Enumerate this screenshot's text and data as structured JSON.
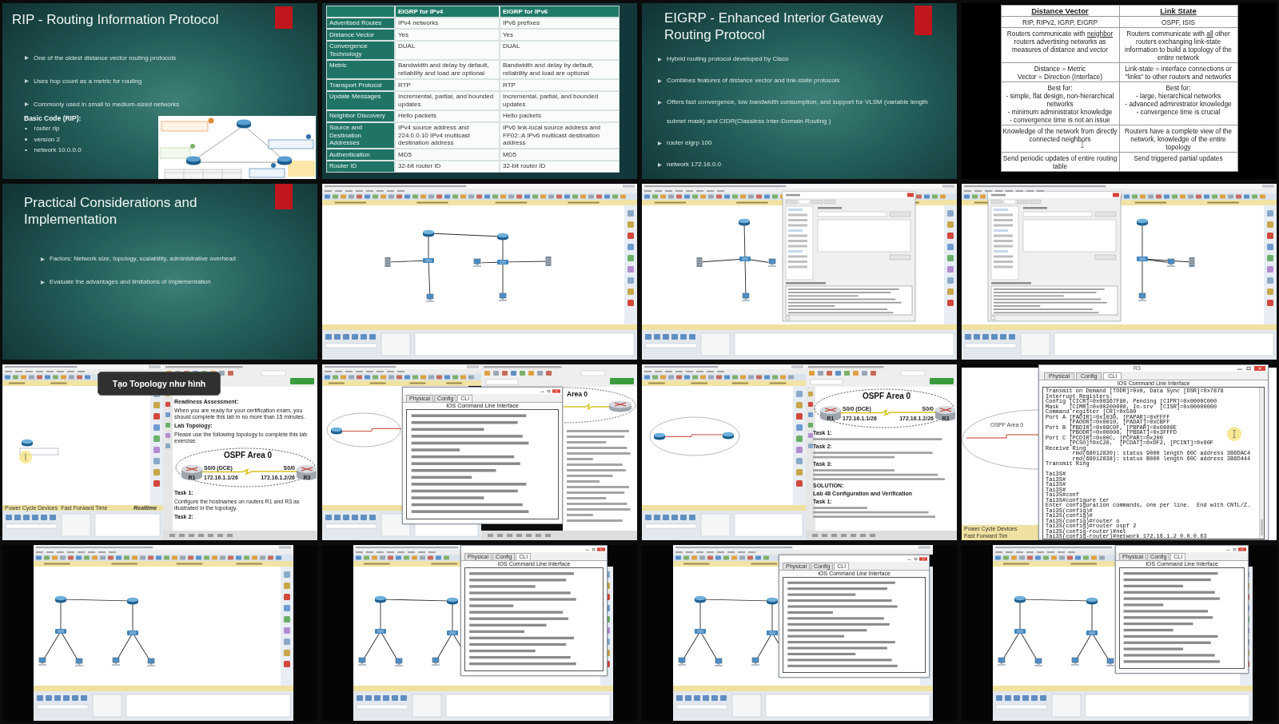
{
  "tiles": [
    {
      "kind": "slide",
      "title": "RIP - Routing Information Protocol",
      "bullets": [
        "One of the oldest distance vector routing protocols",
        "Uses hop count as a metric for routing",
        "Commonly used in small to medium-sized networks"
      ],
      "code": {
        "heading": "Basic Code (RIP):",
        "lines": [
          "router rip",
          "version 2",
          "network 10.0.0.0"
        ]
      },
      "figure": {
        "kind": "routing_diagram"
      }
    },
    {
      "kind": "feature_table",
      "columns": [
        "EIGRP for IPv4",
        "EIGRP for IPv6"
      ],
      "rows": [
        {
          "label": "Advertised Routes",
          "values": [
            "IPv4 networks",
            "IPv6 prefixes"
          ]
        },
        {
          "label": "Distance Vector",
          "values": [
            "Yes",
            "Yes"
          ]
        },
        {
          "label": "Convergence Technology",
          "values": [
            "DUAL",
            "DUAL"
          ]
        },
        {
          "label": "Metric",
          "values": [
            "Bandwidth and delay by default, reliability and load are optional",
            "Bandwidth and delay by default, reliability and load are optional"
          ]
        },
        {
          "label": "Transport Protocol",
          "values": [
            "RTP",
            "RTP"
          ]
        },
        {
          "label": "Update Messages",
          "values": [
            "Incremental, partial, and bounded updates",
            "Incremental, partial, and bounded updates"
          ]
        },
        {
          "label": "Neighbor Discovery",
          "values": [
            "Hello packets",
            "Hello packets"
          ]
        },
        {
          "label": "Source and Destination Addresses",
          "values": [
            "IPv4 source address and 224.0.0.10 IPv4 multicast destination address",
            "IPv6 link-local source address and FF02::A IPv6 multicast destination address"
          ]
        },
        {
          "label": "Authentication",
          "values": [
            "MD5",
            "MD5"
          ]
        },
        {
          "label": "Router ID",
          "values": [
            "32-bit router ID",
            "32-bit router ID"
          ]
        }
      ]
    },
    {
      "kind": "slide",
      "title": "EIGRP - Enhanced Interior Gateway Routing Protocol",
      "bullets": [
        "Hybrid routing protocol developed by Cisco",
        "Combines features of distance vector and link-state protocols",
        "Offers fast convergence, low bandwidth consumption, and support for VLSM (variable length subnet mask) and CIDR(Classless Inter-Domain Routing )",
        "router eigrp 100",
        "network 172.16.0.0"
      ]
    },
    {
      "kind": "comparison_table",
      "columns": [
        "Distance Vector",
        "Link State"
      ],
      "rows": [
        [
          {
            "parts": [
              {
                "text": "RIP, RIPv2, IGRP, EIGRP",
                "underline": false
              }
            ]
          },
          {
            "parts": [
              {
                "text": "OSPF, ISIS",
                "underline": false
              }
            ]
          }
        ],
        [
          {
            "parts": [
              {
                "text": "Routers communicate with ",
                "underline": false
              },
              {
                "text": "neighbor",
                "underline": true
              },
              {
                "text": " routers advertising networks as measures of distance and vector",
                "underline": false
              }
            ]
          },
          {
            "parts": [
              {
                "text": "Routers communicate with ",
                "underline": false
              },
              {
                "text": "all",
                "underline": true
              },
              {
                "text": " other routers exchanging link-state information to build a topology of the entire network",
                "underline": false
              }
            ]
          }
        ],
        [
          {
            "parts": [
              {
                "text": "Distance = Metric\nVector = Direction (Interface)",
                "underline": false
              }
            ]
          },
          {
            "parts": [
              {
                "text": "Link-state = interface connections or \"links\" to other routers and networks",
                "underline": false
              }
            ]
          }
        ],
        [
          {
            "parts": [
              {
                "text": "Best for:\n- simple, flat design, non-hierarchical networks\n- minimum administrator knowledge\n- convergence time is not an issue",
                "underline": false
              }
            ]
          },
          {
            "parts": [
              {
                "text": "Best for:\n- large, hierarchical networks\n- advanced administrator knowledge\n- convergence time is crucial",
                "underline": false
              }
            ]
          }
        ],
        [
          {
            "parts": [
              {
                "text": "Knowledge of the network from directly connected neighbors",
                "underline": false
              }
            ]
          },
          {
            "parts": [
              {
                "text": "Routers have a complete view of the network, knowledge of the entire topology",
                "underline": false
              }
            ]
          }
        ],
        [
          {
            "parts": [
              {
                "text": "Send periodic updates of entire routing table",
                "underline": false
              }
            ]
          },
          {
            "parts": [
              {
                "text": "Send triggered partial updates",
                "underline": false
              }
            ]
          }
        ]
      ]
    },
    {
      "kind": "slide",
      "title": "Practical Considerations and Implementation",
      "bullets": [
        "Factors: Network size, topology, scalability, administrative overhead",
        "Evaluate the advantages and limitations of implementation"
      ]
    },
    {
      "kind": "pt_topology"
    },
    {
      "kind": "pt_config"
    },
    {
      "kind": "pt_config"
    },
    {
      "kind": "pt_lab_doc",
      "caption": "Tạo Topology như hình",
      "status_buttons": [
        "Power Cycle Devices",
        "Fast Forward Time"
      ],
      "mode_label": "Realtime",
      "doc": {
        "intro": [
          {
            "kind": "heading",
            "text": "Readiness Assessment:"
          },
          {
            "kind": "paragraph",
            "text": "When you are ready for your certification exam, you should complete this lab in no more than 15 minutes."
          },
          {
            "kind": "heading",
            "text": "Lab Topology:"
          },
          {
            "kind": "paragraph",
            "text": "Please use the following topology to complete this lab exercise:"
          }
        ],
        "topology": {
          "title": "OSPF Area 0",
          "routers": [
            "R1",
            "R3"
          ],
          "ends": [
            {
              "interface": "S0/0 (DCE)",
              "address": "172.16.1.1/26"
            },
            {
              "interface": "S0/0",
              "address": "172.16.1.2/26"
            }
          ]
        },
        "after": [
          {
            "kind": "heading",
            "text": "Task 1:"
          },
          {
            "kind": "paragraph",
            "text": "Configure the hostnames on routers R1 and R3 as illustrated in the topology."
          },
          {
            "kind": "heading",
            "text": "Task 2:"
          }
        ]
      }
    },
    {
      "kind": "pt_cli_doc",
      "cli": {
        "tabs": [
          {
            "label": "Physical",
            "selected": false
          },
          {
            "label": "Config",
            "selected": false
          },
          {
            "label": "CLI",
            "selected": true
          }
        ],
        "heading": "IOS Command Line Interface"
      },
      "doc_title": "Area 0"
    },
    {
      "kind": "pt_doc",
      "doc": {
        "topology": {
          "title": "OSPF Area 0",
          "routers": [
            "R1",
            "R3"
          ],
          "ends": [
            {
              "interface": "S0/0 (DCE)",
              "address": "172.16.1.1/26"
            },
            {
              "interface": "S0/0",
              "address": "172.16.1.2/26"
            }
          ]
        },
        "headings": [
          "Task 1:",
          "Task 2:",
          "Task 3:",
          "SOLUTION:",
          "Lab 48 Configuration and Verification",
          "Task 1:"
        ]
      }
    },
    {
      "kind": "cli_focus",
      "area_label": "OSPF Area 0",
      "status_buttons": [
        "Power Cycle Devices",
        "Fast Forward Tim"
      ],
      "cli": {
        "window_title": "R3",
        "tabs": [
          {
            "label": "Physical",
            "selected": false
          },
          {
            "label": "Config",
            "selected": false
          },
          {
            "label": "CLI",
            "selected": true
          }
        ],
        "heading": "IOS Command Line Interface",
        "output": [
          [
            "Transmit on Demand [TODR]=0x0, Data Sync [DSR]=0x7878",
            "Interrupt Registers:",
            "Config [CICR]=0x00367F80, Pending [CIPR]=0x0000C000",
            "Mask   [CIMR]=0x00200000, In-srv  [CISR]=0x00000000",
            "Command register [CR]=0x580",
            "Port A [PADIR]=0x1030, [PAPAR]=0xFFFF",
            "       [PAODR]=0x0010, [PADAT]=0xCBFF",
            "Port B [PBDIR]=0x09C0F, [PBPAR]=0x0800E",
            "       [PBODR]=0x00000, [PBDAT]=0x3FFFD",
            "Port C [PCDIR]=0x00C, [PCPAR]=0x200",
            "       [PCSO]=0xC20,  [PCDAT]=0xDF2, [PCINT]=0x00F",
            "Receive Ring",
            "        rmd(68012830): status 9000 length 60C address 3B6DAC4",
            "        rmd(68012838): status B000 length 60C address 3B6D444",
            "Transmit Ring"
          ],
          [
            "Tai3S#",
            "Tai3S#",
            "Tai3S#",
            "Tai3S#",
            "Tai3S#conf",
            "Tai3S#configure ter",
            "Enter configuration commands, one per line.  End with CNTL/Z.",
            "Tai3S(config)#",
            "Tai3S(config)#",
            "Tai3S(config)#router o",
            "Tai3S(config)#router ospf 2",
            "Tai3S(config-router)#net",
            "Tai3S(config-router)#network 172.16.1.2 0.0.0.63"
          ]
        ]
      }
    },
    {
      "kind": "pt_lan"
    },
    {
      "kind": "pt_lan",
      "cli": {
        "tabs": [
          {
            "label": "Physical",
            "selected": false
          },
          {
            "label": "Config",
            "selected": false
          },
          {
            "label": "CLI",
            "selected": true
          }
        ],
        "heading": "IOS Command Line Interface"
      }
    },
    {
      "kind": "pt_lan",
      "cli": {
        "tabs": [
          {
            "label": "Physical",
            "selected": false
          },
          {
            "label": "Config",
            "selected": false
          },
          {
            "label": "CLI",
            "selected": true
          }
        ],
        "heading": "IOS Command Line Interface"
      }
    },
    {
      "kind": "pt_lan",
      "cli": {
        "tabs": [
          {
            "label": "Physical",
            "selected": false
          },
          {
            "label": "Config",
            "selected": false
          },
          {
            "label": "CLI",
            "selected": true
          }
        ],
        "heading": "IOS Command Line Interface"
      }
    }
  ]
}
